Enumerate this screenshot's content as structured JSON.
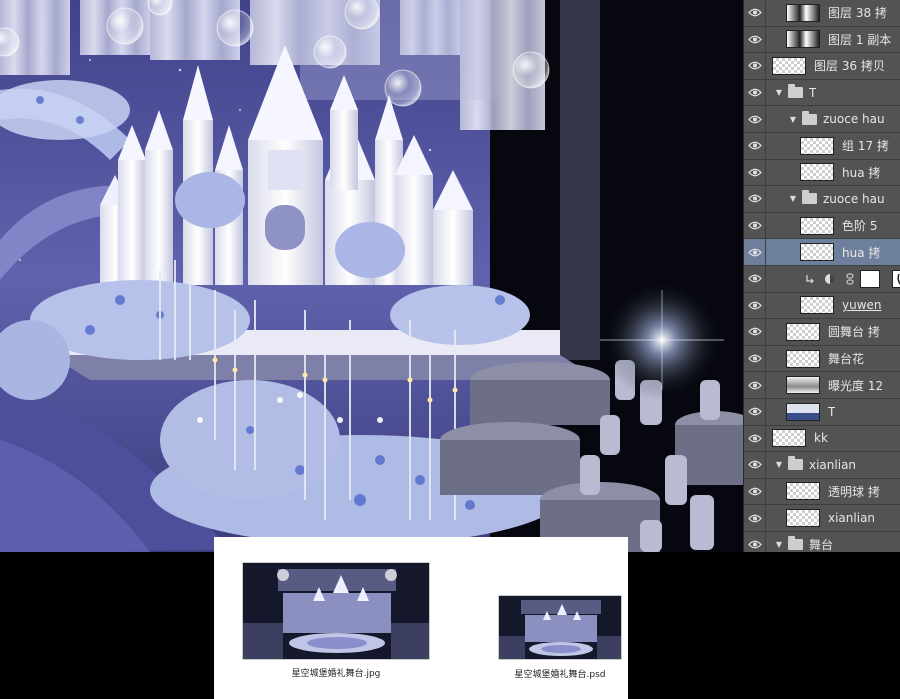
{
  "canvas": {
    "description_icon": "wedding-stage-render"
  },
  "layers_panel": {
    "rows": [
      {
        "name": "图层 38 拷",
        "type": "layer",
        "thumb": "dark",
        "visible": true,
        "indent": 1
      },
      {
        "name": "图层 1 副本",
        "type": "layer",
        "thumb": "dark",
        "visible": true,
        "indent": 1
      },
      {
        "name": "图层 36 拷贝",
        "type": "layer",
        "thumb": "check",
        "visible": true,
        "indent": 0
      },
      {
        "name": "T",
        "type": "group",
        "visible": true,
        "indent": 0,
        "open": true
      },
      {
        "name": "zuoce hau",
        "type": "group",
        "visible": true,
        "indent": 1,
        "open": true
      },
      {
        "name": "组 17 拷",
        "type": "layer",
        "thumb": "check",
        "visible": true,
        "indent": 2
      },
      {
        "name": "hua 拷",
        "type": "layer",
        "thumb": "check",
        "visible": true,
        "indent": 2
      },
      {
        "name": "zuoce hau",
        "type": "group",
        "visible": true,
        "indent": 1,
        "open": true
      },
      {
        "name": "色阶 5",
        "type": "layer",
        "thumb": "check",
        "visible": true,
        "indent": 2
      },
      {
        "name": "hua 拷",
        "type": "layer",
        "thumb": "check",
        "visible": true,
        "indent": 2,
        "selected": true
      },
      {
        "name": "",
        "type": "adjustment",
        "visible": true,
        "indent": 2
      },
      {
        "name": "yuwen",
        "type": "layer",
        "thumb": "check",
        "visible": true,
        "indent": 2,
        "underline": true
      },
      {
        "name": "圆舞台 拷",
        "type": "layer",
        "thumb": "check",
        "visible": true,
        "indent": 1
      },
      {
        "name": "舞台花",
        "type": "layer",
        "thumb": "check",
        "visible": true,
        "indent": 1
      },
      {
        "name": "曝光度 12",
        "type": "layer",
        "thumb": "wave",
        "visible": true,
        "indent": 1
      },
      {
        "name": "T",
        "type": "layer",
        "thumb": "mountain",
        "visible": true,
        "indent": 1
      },
      {
        "name": "kk",
        "type": "layer",
        "thumb": "check",
        "visible": true,
        "indent": 0
      },
      {
        "name": "xianlian",
        "type": "group",
        "visible": true,
        "indent": 0,
        "open": true
      },
      {
        "name": "透明球 拷",
        "type": "layer",
        "thumb": "check",
        "visible": true,
        "indent": 1
      },
      {
        "name": "xianlian",
        "type": "layer",
        "thumb": "check",
        "visible": true,
        "indent": 1
      },
      {
        "name": "舞台",
        "type": "group",
        "visible": true,
        "indent": 0,
        "open": true
      }
    ]
  },
  "preview": {
    "files": [
      {
        "label": "星空城堡婚礼舞台.jpg"
      },
      {
        "label": "星空城堡婚礼舞台.psd"
      }
    ]
  }
}
